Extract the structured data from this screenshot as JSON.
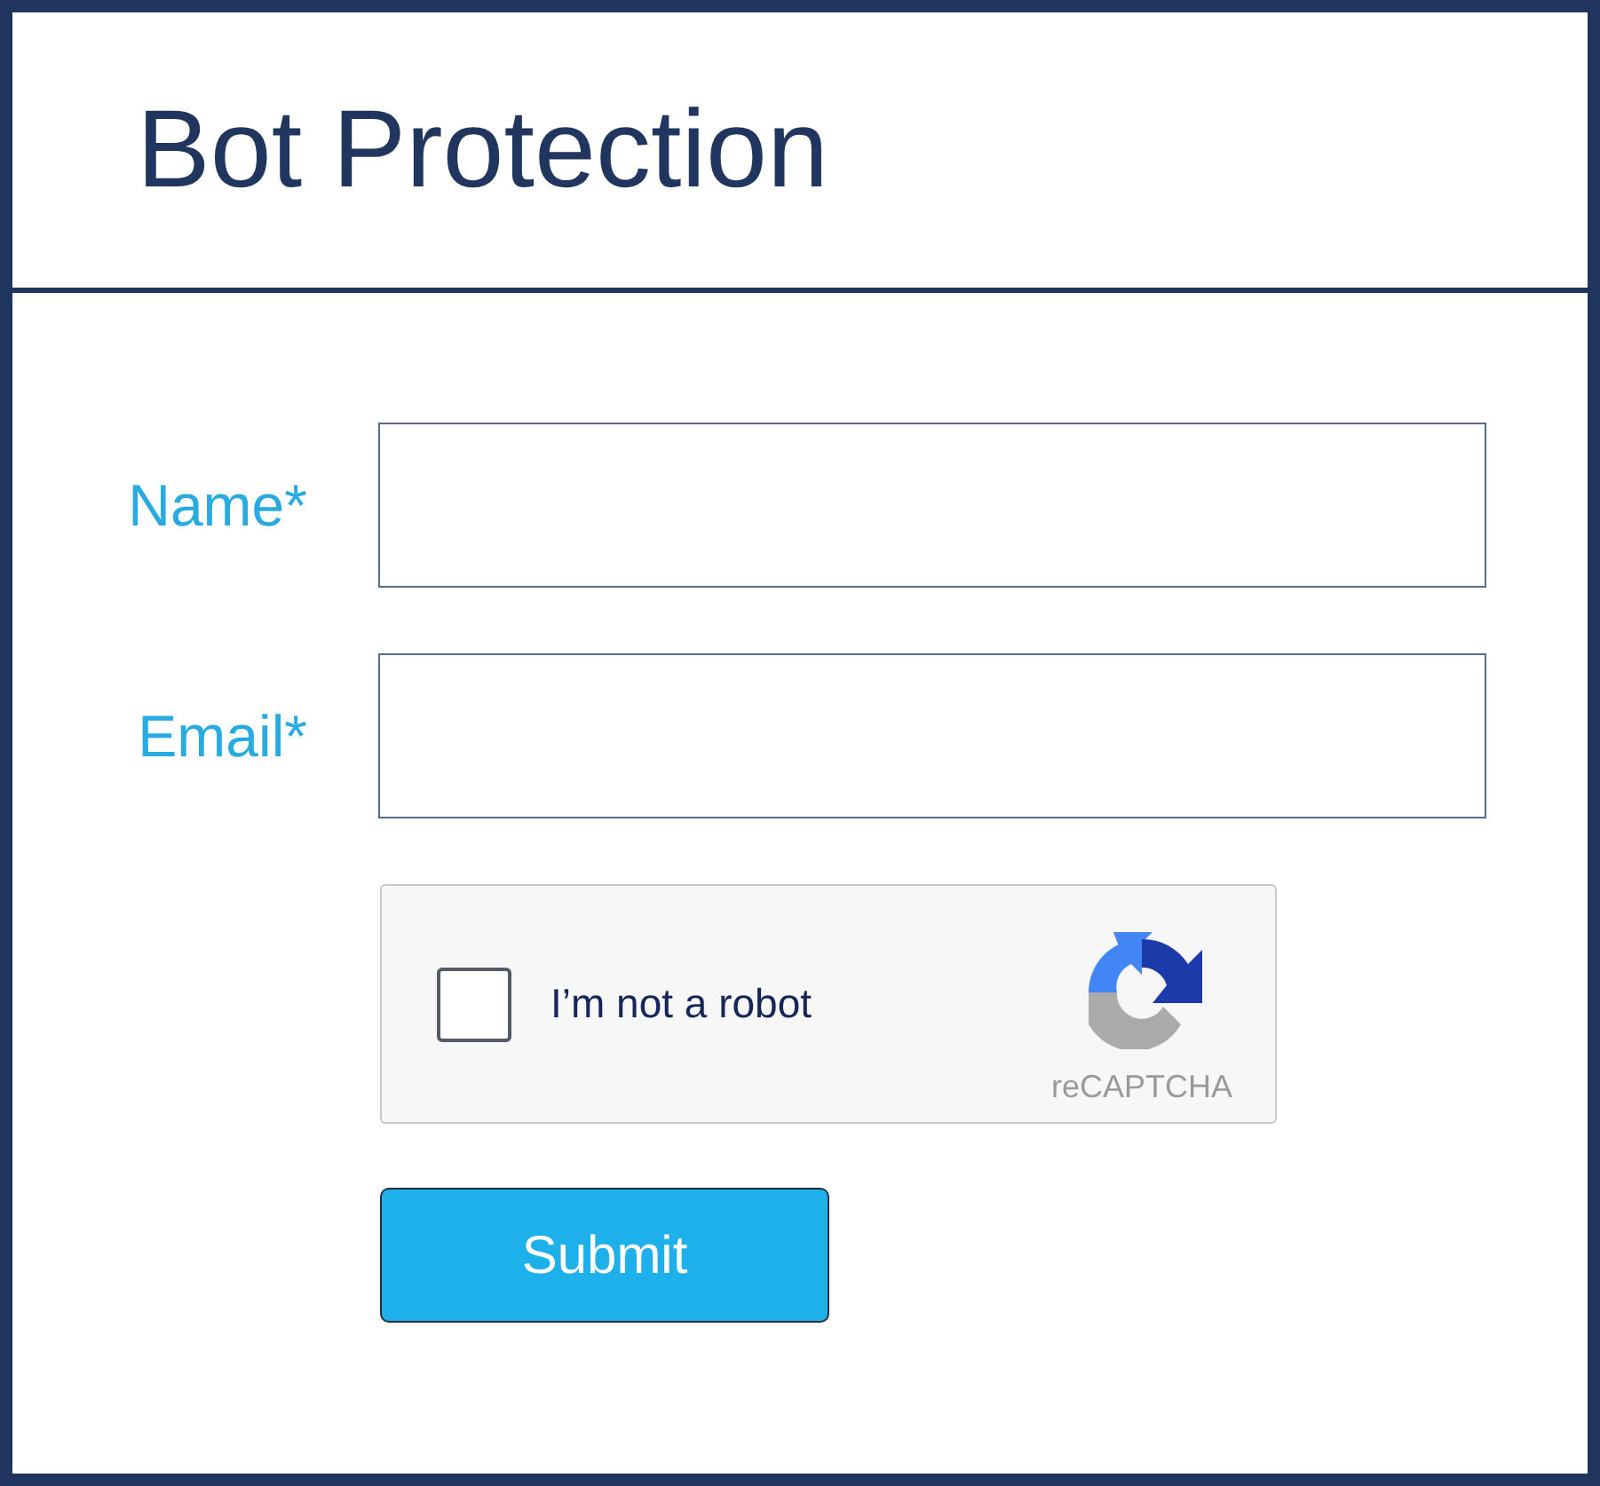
{
  "title": "Bot Protection",
  "fields": [
    {
      "label": "Name*"
    },
    {
      "label": "Email*"
    }
  ],
  "captcha": {
    "checked": false,
    "label": "I’m not a robot",
    "brand": "reCAPTCHA"
  },
  "submit": {
    "label": "Submit"
  }
}
